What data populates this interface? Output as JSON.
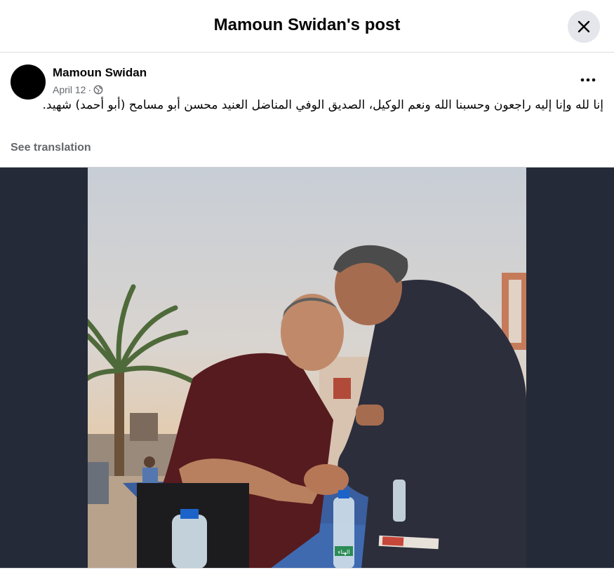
{
  "header": {
    "title": "Mamoun Swidan's post",
    "close_icon": "close-icon"
  },
  "post": {
    "author": "Mamoun Swidan",
    "date": "April 12",
    "separator": "·",
    "audience_icon": "globe-icon",
    "more_icon": "more-options-icon",
    "text": "إنا لله وإنا إليه راجعون وحسبنا الله ونعم الوكيل، الصديق الوفي المناضل العنيد محسن أبو مسامح (أبو أحمد) شهيد.",
    "see_translation": "See translation"
  },
  "photo": {
    "bottle_label": "الهناء"
  },
  "colors": {
    "media_background": "#242a37",
    "button_background": "#e4e6eb",
    "secondary_text": "#65676b"
  }
}
